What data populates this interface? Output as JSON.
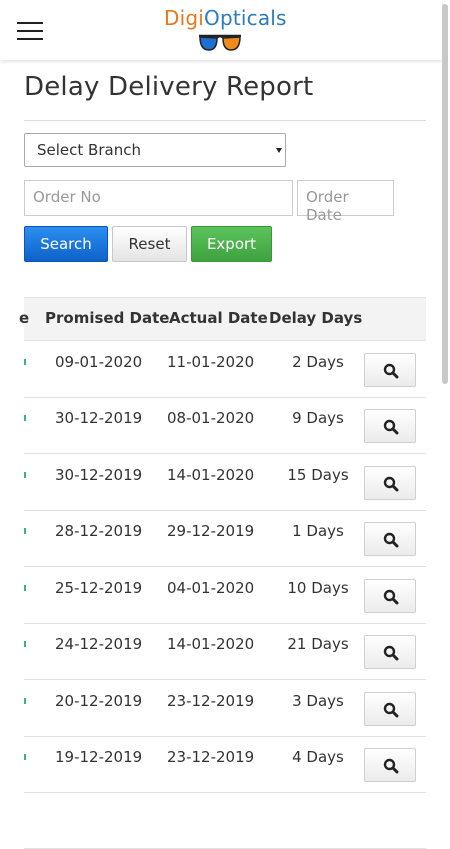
{
  "brand": {
    "part1": "Digi",
    "part2": "Opticals"
  },
  "page": {
    "title": "Delay Delivery Report"
  },
  "filters": {
    "branch_selected": "Select Branch",
    "order_no_placeholder": "Order No",
    "order_date_placeholder": "Order Date"
  },
  "buttons": {
    "search": "Search",
    "reset": "Reset",
    "export": "Export"
  },
  "table": {
    "partial_header_fragment": "e",
    "columns": [
      "Promised Date",
      "Actual Date",
      "Delay Days"
    ],
    "rows": [
      {
        "promised": "09-01-2020",
        "actual": "11-01-2020",
        "delay": "2 Days"
      },
      {
        "promised": "30-12-2019",
        "actual": "08-01-2020",
        "delay": "9 Days"
      },
      {
        "promised": "30-12-2019",
        "actual": "14-01-2020",
        "delay": "15 Days"
      },
      {
        "promised": "28-12-2019",
        "actual": "29-12-2019",
        "delay": "1 Days"
      },
      {
        "promised": "25-12-2019",
        "actual": "04-01-2020",
        "delay": "10 Days"
      },
      {
        "promised": "24-12-2019",
        "actual": "14-01-2020",
        "delay": "21 Days"
      },
      {
        "promised": "20-12-2019",
        "actual": "23-12-2019",
        "delay": "3 Days"
      },
      {
        "promised": "19-12-2019",
        "actual": "23-12-2019",
        "delay": "4 Days"
      }
    ]
  },
  "icons": {
    "menu": "hamburger-menu-icon",
    "logo": "glasses-icon",
    "view": "magnifier-icon",
    "select": "caret-down-icon"
  },
  "colors": {
    "brand_orange": "#e8781c",
    "brand_blue": "#2a7bbf",
    "search_blue": "#1a73d9",
    "export_green": "#4cb24c"
  }
}
